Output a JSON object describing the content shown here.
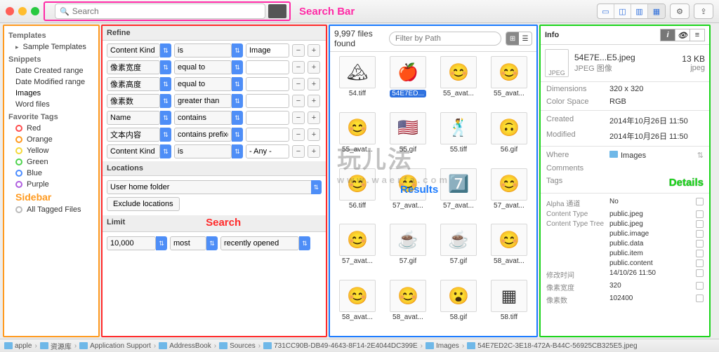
{
  "toolbar": {
    "search_placeholder": "Search",
    "search_bar_label": "Search Bar"
  },
  "sidebar": {
    "groups": [
      {
        "title": "Templates",
        "items": [
          {
            "label": "Sample Templates",
            "expandable": true
          }
        ]
      },
      {
        "title": "Snippets",
        "items": [
          {
            "label": "Date Created range"
          },
          {
            "label": "Date Modified range"
          },
          {
            "label": "Images"
          },
          {
            "label": "Word files"
          }
        ]
      },
      {
        "title": "Favorite Tags",
        "items": [
          {
            "label": "Red",
            "color": "#ff4d4d"
          },
          {
            "label": "Orange",
            "color": "#ff9a1f"
          },
          {
            "label": "Yellow",
            "color": "#f5d93a"
          },
          {
            "label": "Green",
            "color": "#4fd44f"
          },
          {
            "label": "Blue",
            "color": "#4b8cff"
          },
          {
            "label": "Purple",
            "color": "#b05fe0"
          }
        ]
      }
    ],
    "all_tagged": "All Tagged Files",
    "annotation": "Sidebar"
  },
  "search": {
    "refine_title": "Refine",
    "rows": [
      {
        "field": "Content Kind",
        "op": "is",
        "val": "Image"
      },
      {
        "field": "像素宽度",
        "op": "equal to",
        "val": ""
      },
      {
        "field": "像素高度",
        "op": "equal to",
        "val": ""
      },
      {
        "field": "像素数",
        "op": "greater than",
        "val": ""
      },
      {
        "field": "Name",
        "op": "contains",
        "val": ""
      },
      {
        "field": "文本内容",
        "op": "contains prefixes",
        "val": ""
      },
      {
        "field": "Content Kind",
        "op": "is",
        "val": "- Any -"
      }
    ],
    "locations_title": "Locations",
    "location_value": "User home folder",
    "exclude_btn": "Exclude locations",
    "limit_title": "Limit",
    "limit_count": "10,000",
    "limit_mode": "most",
    "limit_order": "recently opened",
    "annotation": "Search"
  },
  "results": {
    "count_text": "9,997 files found",
    "filter_placeholder": "Filter by Path",
    "items": [
      {
        "name": "54.tiff",
        "emoji": "🏔"
      },
      {
        "name": "54E7ED...",
        "emoji": "🍎",
        "selected": true
      },
      {
        "name": "55_avat...",
        "emoji": "😊"
      },
      {
        "name": "55_avat...",
        "emoji": "😊"
      },
      {
        "name": "55_avat...",
        "emoji": "😊"
      },
      {
        "name": "55.gif",
        "emoji": "🇺🇸"
      },
      {
        "name": "55.tiff",
        "emoji": "🕺"
      },
      {
        "name": "56.gif",
        "emoji": "🙃"
      },
      {
        "name": "56.tiff",
        "emoji": "😊"
      },
      {
        "name": "57_avat...",
        "emoji": "😊"
      },
      {
        "name": "57_avat...",
        "emoji": "7️⃣"
      },
      {
        "name": "57_avat...",
        "emoji": "😊"
      },
      {
        "name": "57_avat...",
        "emoji": "😊"
      },
      {
        "name": "57.gif",
        "emoji": "☕"
      },
      {
        "name": "57.gif",
        "emoji": "☕"
      },
      {
        "name": "58_avat...",
        "emoji": "😊"
      },
      {
        "name": "58_avat...",
        "emoji": "😊"
      },
      {
        "name": "58_avat...",
        "emoji": "😊"
      },
      {
        "name": "58.gif",
        "emoji": "😮"
      },
      {
        "name": "58.tiff",
        "emoji": "▦"
      }
    ],
    "annotation": "Results"
  },
  "details": {
    "title": "Info",
    "filename": "54E7E...E5.jpeg",
    "kind": "JPEG 图像",
    "size": "13 KB",
    "ext": "jpeg",
    "rows": [
      {
        "k": "Dimensions",
        "v": "320 x 320"
      },
      {
        "k": "Color Space",
        "v": "RGB"
      }
    ],
    "dates": [
      {
        "k": "Created",
        "v": "2014年10月26日 11:50"
      },
      {
        "k": "Modified",
        "v": "2014年10月26日 11:50"
      }
    ],
    "where_label": "Where",
    "where_value": "Images",
    "comments_label": "Comments",
    "tags_label": "Tags",
    "meta": [
      {
        "k": "Alpha 通道",
        "v": "No"
      },
      {
        "k": "Content Type",
        "v": "public.jpeg"
      },
      {
        "k": "Content Type Tree",
        "v": "public.jpeg"
      },
      {
        "k": "",
        "v": "public.image"
      },
      {
        "k": "",
        "v": "public.data"
      },
      {
        "k": "",
        "v": "public.item"
      },
      {
        "k": "",
        "v": "public.content"
      },
      {
        "k": "修改时间",
        "v": "14/10/26 11:50"
      },
      {
        "k": "像素宽度",
        "v": "320"
      },
      {
        "k": "像素数",
        "v": "102400"
      }
    ],
    "annotation": "Details"
  },
  "pathbar": [
    "apple",
    "资源库",
    "Application Support",
    "AddressBook",
    "Sources",
    "731CC90B-DB49-4643-8F14-2E4044DC399E",
    "Images",
    "54E7ED2C-3E18-472A-B44C-56925CB325E5.jpeg"
  ],
  "watermark": {
    "main": "玩儿法",
    "sub": "www.waerfa.com"
  }
}
